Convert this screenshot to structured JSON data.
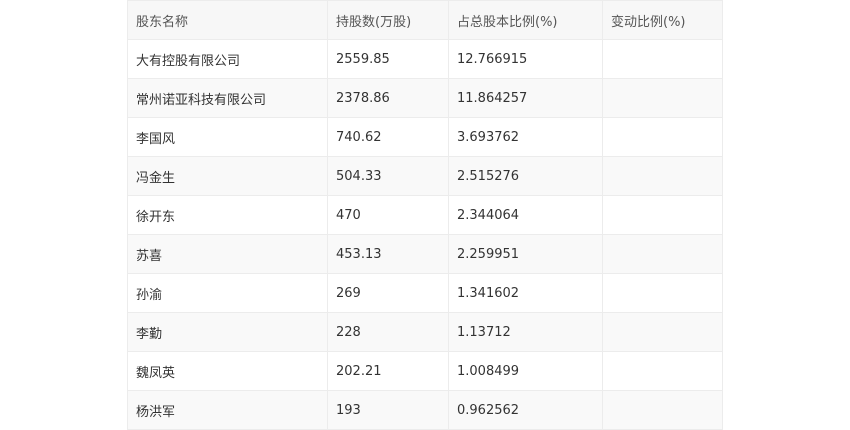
{
  "table": {
    "headers": [
      "股东名称",
      "持股数(万股)",
      "占总股本比例(%)",
      "变动比例(%)"
    ],
    "rows": [
      [
        "大有控股有限公司",
        "2559.85",
        "12.766915",
        ""
      ],
      [
        "常州诺亚科技有限公司",
        "2378.86",
        "11.864257",
        ""
      ],
      [
        "李国风",
        "740.62",
        "3.693762",
        ""
      ],
      [
        "冯金生",
        "504.33",
        "2.515276",
        ""
      ],
      [
        "徐开东",
        "470",
        "2.344064",
        ""
      ],
      [
        "苏喜",
        "453.13",
        "2.259951",
        ""
      ],
      [
        "孙渝",
        "269",
        "1.341602",
        ""
      ],
      [
        "李勤",
        "228",
        "1.13712",
        ""
      ],
      [
        "魏凤英",
        "202.21",
        "1.008499",
        ""
      ],
      [
        "杨洪军",
        "193",
        "0.962562",
        ""
      ]
    ]
  },
  "colors": {
    "header_bg": "#f7f7f7",
    "stripe_bg": "#f9f9f9",
    "border": "#ececec",
    "text": "#333333"
  }
}
